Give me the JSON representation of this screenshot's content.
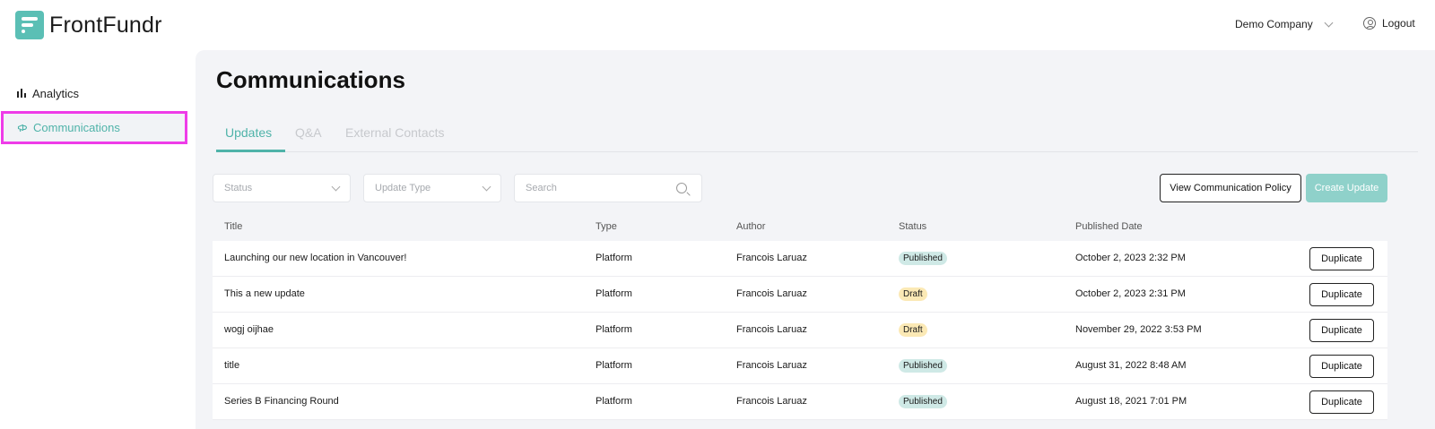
{
  "header": {
    "app_name": "FrontFundr",
    "company": "Demo Company",
    "logout_label": "Logout"
  },
  "sidebar": {
    "items": [
      {
        "label": "Analytics",
        "icon": "bar-chart-icon",
        "active": false
      },
      {
        "label": "Communications",
        "icon": "megaphone-icon",
        "active": true
      }
    ]
  },
  "main": {
    "title": "Communications",
    "tabs": [
      {
        "label": "Updates",
        "active": true
      },
      {
        "label": "Q&A",
        "active": false
      },
      {
        "label": "External Contacts",
        "active": false
      }
    ],
    "filters": {
      "status_placeholder": "Status",
      "type_placeholder": "Update Type",
      "search_placeholder": "Search"
    },
    "buttons": {
      "policy": "View Communication Policy",
      "create": "Create Update"
    },
    "table": {
      "headers": [
        "Title",
        "Type",
        "Author",
        "Status",
        "Published Date"
      ],
      "duplicate_label": "Duplicate",
      "rows": [
        {
          "title": "Launching our new location in Vancouver!",
          "type": "Platform",
          "author": "Francois Laruaz",
          "status": "Published",
          "date": "October 2, 2023 2:32 PM"
        },
        {
          "title": "This a new update",
          "type": "Platform",
          "author": "Francois Laruaz",
          "status": "Draft",
          "date": "October 2, 2023 2:31 PM"
        },
        {
          "title": "wogj oijhae",
          "type": "Platform",
          "author": "Francois Laruaz",
          "status": "Draft",
          "date": "November 29, 2022 3:53 PM"
        },
        {
          "title": "title",
          "type": "Platform",
          "author": "Francois Laruaz",
          "status": "Published",
          "date": "August 31, 2022 8:48 AM"
        },
        {
          "title": "Series B Financing Round",
          "type": "Platform",
          "author": "Francois Laruaz",
          "status": "Published",
          "date": "August 18, 2021 7:01 PM"
        }
      ]
    }
  },
  "colors": {
    "accent": "#4fb3a9",
    "highlight_border": "#ee3ce8",
    "published_badge": "#cfe9e6",
    "draft_badge": "#fbe9b5"
  }
}
